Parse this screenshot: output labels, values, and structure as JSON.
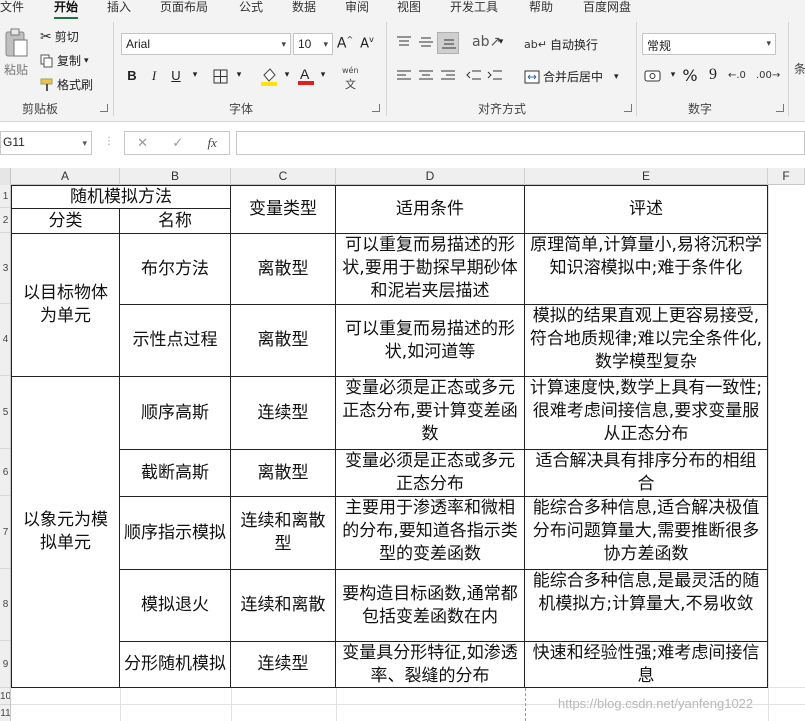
{
  "ribbon": {
    "tabs": [
      "文件",
      "开始",
      "插入",
      "页面布局",
      "公式",
      "数据",
      "审阅",
      "视图",
      "开发工具",
      "帮助",
      "百度网盘"
    ],
    "active_tab": "开始",
    "clipboard": {
      "paste": "粘贴",
      "cut": "剪切",
      "copy": "复制",
      "format_painter": "格式刷",
      "label": "剪贴板"
    },
    "font": {
      "name": "Arial",
      "size": "10",
      "bold": "B",
      "italic": "I",
      "underline": "U",
      "label": "字体",
      "phonetic": "wén"
    },
    "alignment": {
      "wrap_text": "自动换行",
      "merge_center": "合并后居中",
      "label": "对齐方式"
    },
    "number": {
      "format": "常规",
      "percent": "%",
      "comma": "9",
      "label": "数字"
    },
    "styles_partial": "条",
    "colors": {
      "accent": "#217346",
      "font_color": "#e02020",
      "highlight": "#ffe600"
    }
  },
  "formula_bar": {
    "name_box": "G11",
    "cancel": "✕",
    "enter": "✓",
    "fx": "fx",
    "value": ""
  },
  "columns": [
    "A",
    "B",
    "C",
    "D",
    "E",
    "F"
  ],
  "rows": [
    "1",
    "2",
    "3",
    "4",
    "5",
    "6",
    "7",
    "8",
    "9",
    "10",
    "11"
  ],
  "table": {
    "header": {
      "method": "随机模拟方法",
      "category": "分类",
      "name": "名称",
      "variable_type": "变量类型",
      "conditions": "适用条件",
      "comments": "评述"
    },
    "groups": [
      {
        "category": "以目标物体为单元"
      },
      {
        "category": "以象元为模拟单元"
      }
    ],
    "entries": [
      {
        "name": "布尔方法",
        "type": "离散型",
        "condition": "可以重复而易描述的形状,要用于勘探早期砂体和泥岩夹层描述",
        "comment": "原理简单,计算量小,易将沉积学知识溶模拟中;难于条件化"
      },
      {
        "name": "示性点过程",
        "type": "离散型",
        "condition": "可以重复而易描述的形状,如河道等",
        "comment": "模拟的结果直观上更容易接受,符合地质规律;难以完全条件化,数学模型复杂"
      },
      {
        "name": "顺序高斯",
        "type": "连续型",
        "condition": "变量必须是正态或多元正态分布,要计算变差函数",
        "comment": "计算速度快,数学上具有一致性;很难考虑间接信息,要求变量服从正态分布"
      },
      {
        "name": "截断高斯",
        "type": "离散型",
        "condition": "变量必须是正态或多元正态分布",
        "comment": "适合解决具有排序分布的相组合"
      },
      {
        "name": "顺序指示模拟",
        "type": "连续和离散型",
        "condition": "主要用于渗透率和微相的分布,要知道各指示类型的变差函数",
        "comment": "能综合多种信息,适合解决极值分布问题算量大,需要推断很多协方差函数"
      },
      {
        "name": "模拟退火",
        "type": "连续和离散",
        "condition": "要构造目标函数,通常都包括变差函数在内",
        "comment": "能综合多种信息,是最灵活的随机模拟方;计算量大,不易收敛"
      },
      {
        "name": "分形随机模拟",
        "type": "连续型",
        "condition": "变量具分形特征,如渗透率、裂缝的分布",
        "comment": "快速和经验性强;难考虑间接信息"
      }
    ]
  },
  "watermark": "https://blog.csdn.net/yanfeng1022"
}
